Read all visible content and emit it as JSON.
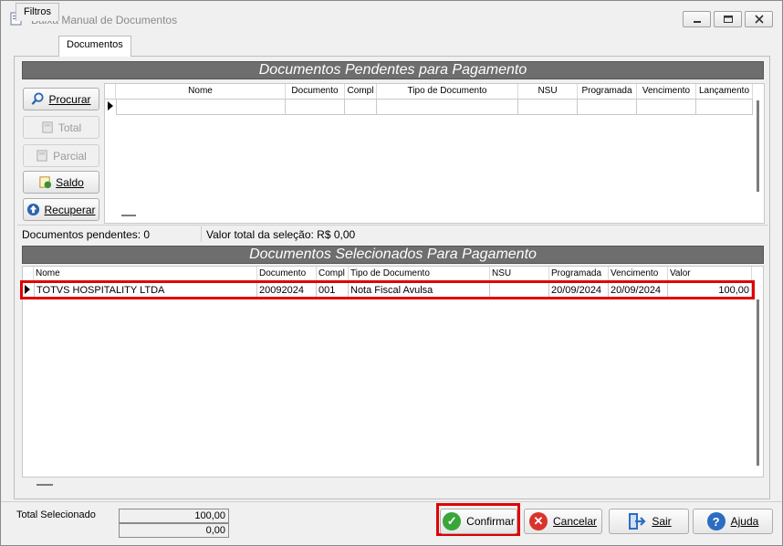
{
  "window": {
    "title": "Baixa Manual de Documentos"
  },
  "tabs": [
    {
      "label": "Filtros"
    },
    {
      "label": "Documentos"
    }
  ],
  "pending": {
    "section_title": "Documentos Pendentes para Pagamento",
    "buttons": {
      "procurar": "Procurar",
      "total": "Total",
      "parcial": "Parcial",
      "saldo": "Saldo",
      "recuperar": "Recuperar"
    },
    "columns": [
      "Nome",
      "Documento",
      "Compl",
      "Tipo de Documento",
      "NSU",
      "Programada",
      "Vencimento",
      "Lançamento"
    ],
    "status": {
      "count_text": "Documentos pendentes: 0",
      "value_text": "Valor total da seleção: R$ 0,00"
    }
  },
  "selected": {
    "section_title": "Documentos Selecionados Para Pagamento",
    "columns": [
      "Nome",
      "Documento",
      "Compl",
      "Tipo de Documento",
      "NSU",
      "Programada",
      "Vencimento",
      "Valor"
    ],
    "rows": [
      [
        "TOTVS HOSPITALITY LTDA",
        "20092024",
        "001",
        "Nota Fiscal Avulsa",
        "",
        "20/09/2024",
        "20/09/2024",
        "100,00"
      ]
    ]
  },
  "totals": {
    "label": "Total Selecionado",
    "value1": "100,00",
    "value2": "0,00"
  },
  "actions": {
    "confirmar": "Confirmar",
    "cancelar": "Cancelar",
    "sair": "Sair",
    "ajuda": "Ajuda"
  },
  "colors": {
    "section_bar": "#6e6e6e",
    "highlight": "#e00000",
    "confirm_green": "#3aa63a",
    "cancel_red": "#d9342b",
    "help_blue": "#2d6cc0"
  }
}
